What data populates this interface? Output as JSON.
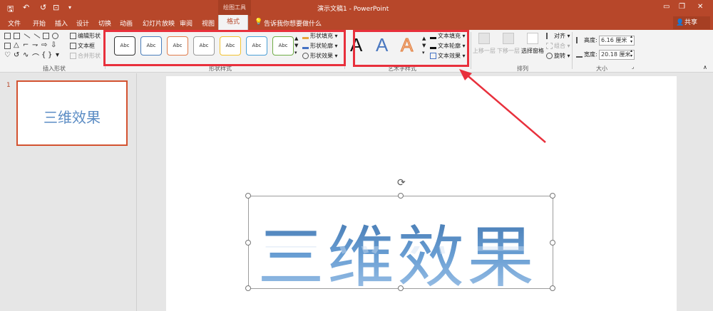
{
  "titlebar": {
    "title": "演示文稿1 - PowerPoint",
    "tool_context": "绘图工具",
    "qa_save": "🖫",
    "qa_undo": "↶",
    "qa_redo": "↺",
    "qa_present": "⊡",
    "qa_more": "▾"
  },
  "tabs": [
    "文件",
    "开始",
    "插入",
    "设计",
    "切换",
    "动画",
    "幻灯片放映",
    "审阅",
    "视图"
  ],
  "active_tab": "格式",
  "tell_me": "告诉我你想要做什么",
  "share": "共享",
  "ribbon": {
    "insert_shapes": {
      "label": "插入形状",
      "edit_shape": "编辑形状",
      "text_box": "文本框",
      "merge_shapes": "合并形状"
    },
    "shape_styles": {
      "label": "形状样式",
      "items": [
        "Abc",
        "Abc",
        "Abc",
        "Abc",
        "Abc",
        "Abc",
        "Abc"
      ],
      "border_colors": [
        "#333333",
        "#4a7ebb",
        "#e07b4a",
        "#9a9a9a",
        "#f2c230",
        "#4a9fd6",
        "#70ad47"
      ],
      "fill": "形状填充",
      "outline": "形状轮廓",
      "effects": "形状效果"
    },
    "wordart_styles": {
      "label": "艺术字样式",
      "letters": [
        "A",
        "A",
        "A"
      ],
      "text_fill": "文本填充",
      "text_outline": "文本轮廓",
      "text_effects": "文本效果"
    },
    "arrange": {
      "label": "排列",
      "bring_forward": "上移一层",
      "send_backward": "下移一层",
      "selection_pane": "选择窗格",
      "align": "对齐",
      "group": "组合",
      "rotate": "旋转"
    },
    "size": {
      "label": "大小",
      "height_label": "高度:",
      "height_value": "6.16 厘米",
      "width_label": "宽度:",
      "width_value": "20.18 厘米"
    }
  },
  "slides": {
    "number": "1",
    "thumb_text": "三维效果"
  },
  "canvas": {
    "text": "三维效果"
  },
  "colors": {
    "accent": "#b7472a",
    "highlight": "#e8303c"
  }
}
